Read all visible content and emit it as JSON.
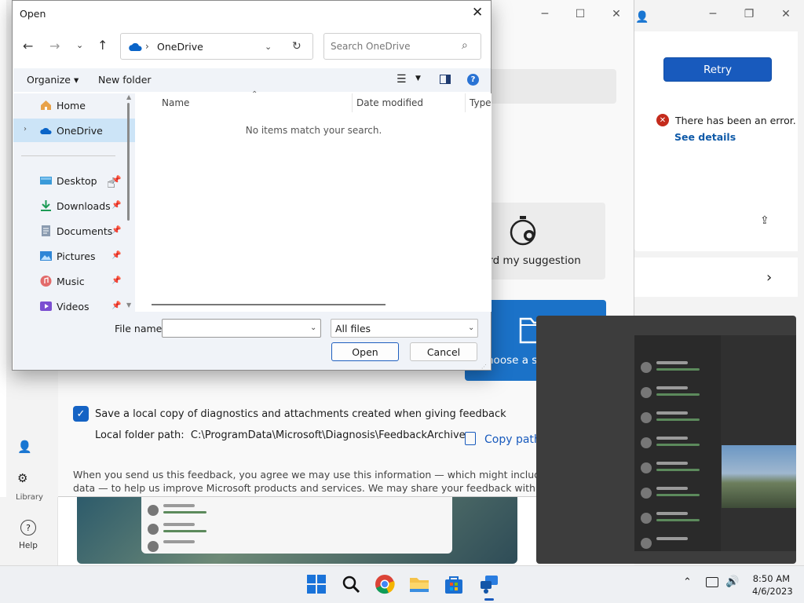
{
  "right_panel": {
    "retry_label": "Retry",
    "error_text": "There has been an error.",
    "see_details": "See details"
  },
  "main": {
    "record_label": "ord my suggestion",
    "screenshot_label": "hoose a screenshot",
    "save_copy_label": "Save a local copy of diagnostics and attachments created when giving feedback",
    "folder_path_label": "Local folder path:",
    "folder_path_value": "C:\\ProgramData\\Microsoft\\Diagnosis\\FeedbackArchive",
    "copy_path_label": "Copy path",
    "agreement_text": "When you send us this feedback, you agree we may use this information — which might include diagnostic data — to help us improve Microsoft products and services. We may share your feedback with partners, including diagnostic",
    "save_copy_checked": true
  },
  "sidebar": {
    "library_label": "Library",
    "help_label": "Help"
  },
  "dialog": {
    "title": "Open",
    "address": "OneDrive",
    "search_placeholder": "Search OneDrive",
    "toolbar": {
      "organize": "Organize",
      "new_folder": "New folder"
    },
    "nav_items": [
      {
        "label": "Home",
        "icon": "home-icon",
        "pinned": false
      },
      {
        "label": "OneDrive",
        "icon": "onedrive-icon",
        "pinned": false,
        "selected": true
      },
      {
        "label": "Desktop",
        "icon": "desktop-icon",
        "pinned": true
      },
      {
        "label": "Downloads",
        "icon": "downloads-icon",
        "pinned": true
      },
      {
        "label": "Documents",
        "icon": "documents-icon",
        "pinned": true
      },
      {
        "label": "Pictures",
        "icon": "pictures-icon",
        "pinned": true
      },
      {
        "label": "Music",
        "icon": "music-icon",
        "pinned": true
      },
      {
        "label": "Videos",
        "icon": "videos-icon",
        "pinned": true
      }
    ],
    "columns": [
      "Name",
      "Date modified",
      "Type"
    ],
    "empty_message": "No items match your search.",
    "file_name_label": "File name:",
    "file_name_value": "",
    "file_type_value": "All files",
    "open_label": "Open",
    "cancel_label": "Cancel"
  },
  "taskbar": {
    "time": "8:50 AM",
    "date": "4/6/2023",
    "apps": [
      "start-icon",
      "search-icon",
      "chrome-icon",
      "file-explorer-icon",
      "store-icon",
      "feedback-hub-icon"
    ]
  },
  "colors": {
    "accent": "#185abd",
    "error": "#c42b1c",
    "tile_blue": "#1b72c8"
  }
}
